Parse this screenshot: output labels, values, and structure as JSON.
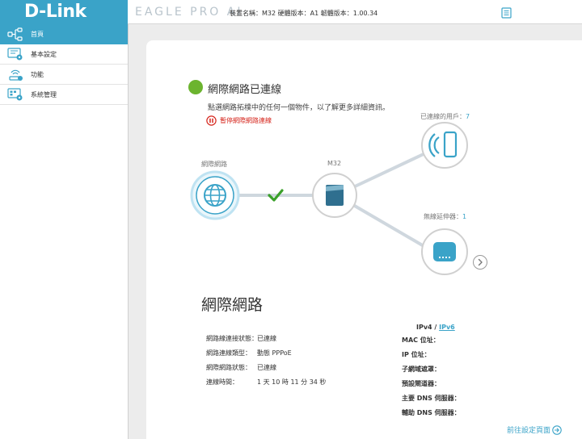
{
  "header": {
    "brand": "D-Link",
    "product": "EAGLE PRO AI",
    "device_info": "裝置名稱：M32 硬體版本：A1 韌體版本：1.00.34"
  },
  "sidebar": {
    "items": [
      {
        "label": "首頁",
        "icon": "home-network-icon",
        "active": true
      },
      {
        "label": "基本設定",
        "icon": "settings-gear-icon",
        "active": false
      },
      {
        "label": "功能",
        "icon": "features-icon",
        "active": false
      },
      {
        "label": "系統管理",
        "icon": "management-icon",
        "active": false
      }
    ]
  },
  "status": {
    "title": "網際網路已連線",
    "description": "點選網路拓樸中的任何一個物件，以了解更多詳細資訊。",
    "pause_label": "暫停網際網路連線"
  },
  "topology": {
    "internet_label": "網際網路",
    "router_label": "M32",
    "clients_label": "已連線的用戶：",
    "clients_count": "7",
    "extenders_label": "無線延伸器：",
    "extenders_count": "1"
  },
  "internet_section": {
    "title": "網際網路",
    "rows": [
      {
        "label": "網路線連接狀態：",
        "value": "已連線"
      },
      {
        "label": "網路連線類型：",
        "value": "動態 PPPoE"
      },
      {
        "label": "網際網路狀態：",
        "value": "已連線"
      },
      {
        "label": "連線時間：",
        "value": "1 天 10 時 11 分 34 秒"
      }
    ],
    "ip_toggle": {
      "ipv4": "IPv4",
      "sep": " / ",
      "ipv6": "IPv6"
    },
    "ip_rows": [
      {
        "label": "MAC 位址："
      },
      {
        "label": "IP 位址："
      },
      {
        "label": "子網域遮罩："
      },
      {
        "label": "預設閘道器："
      },
      {
        "label": "主要 DNS 伺服器："
      },
      {
        "label": "輔助 DNS 伺服器："
      }
    ],
    "goto_settings": "前往設定頁面"
  },
  "colors": {
    "brand": "#3aa3c8",
    "connected": "#6cb42f",
    "warning": "#d6271e"
  }
}
